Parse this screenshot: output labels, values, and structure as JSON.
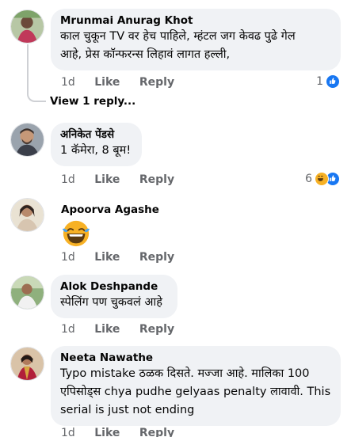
{
  "comments": [
    {
      "author": "Mrunmai Anurag Khot",
      "text_line1": "काल चुकून TV वर हेच पाहिले,  म्हंटल जग केवढ पुढे गेल",
      "text_line2": "आहे,  प्रेस कॉन्फरन्स लिहावं लागत हल्ली,",
      "time": "1d",
      "like_label": "Like",
      "reply_label": "Reply",
      "reaction_count": "1",
      "reaction_icons": [
        "like-icon"
      ],
      "view_replies": "View 1 reply..."
    },
    {
      "author": "अनिकेत पेंडसे",
      "text_line1": "1 कॅमेरा, 8 बूम!",
      "time": "1d",
      "like_label": "Like",
      "reply_label": "Reply",
      "reaction_count": "6",
      "reaction_icons": [
        "haha-icon",
        "like-icon"
      ]
    },
    {
      "author": "Apoorva Agashe",
      "text_line1": "",
      "sticker": "laughing-emoji",
      "time": "1d",
      "like_label": "Like",
      "reply_label": "Reply"
    },
    {
      "author": "Alok Deshpande",
      "text_line1": "स्पेलिंग पण चुकवलं आहे",
      "time": "1d",
      "like_label": "Like",
      "reply_label": "Reply"
    },
    {
      "author": "Neeta Nawathe",
      "text_line1": "Typo mistake ठळक दिसते. मज्जा आहे. मालिका 100",
      "text_line2": "एपिसोड्स chya pudhe gelyaas penalty लावावी. This",
      "text_line3": "serial is just not ending",
      "time": "1d",
      "like_label": "Like",
      "reply_label": "Reply"
    }
  ],
  "colors": {
    "bubble": "#f0f2f5",
    "meta_text": "#65676b",
    "like_blue": "#1877f2",
    "haha_yellow": "#f7b125"
  }
}
